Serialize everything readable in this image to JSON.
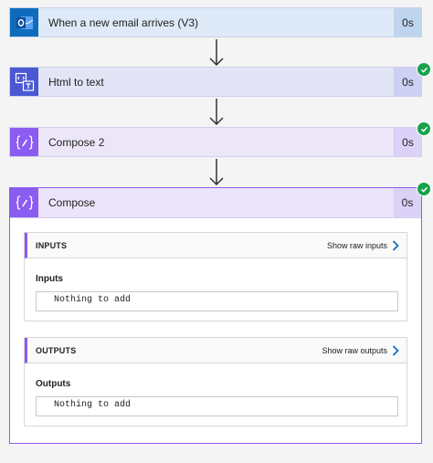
{
  "steps": [
    {
      "label": "When a new email arrives (V3)",
      "duration": "0s",
      "icon": "outlook-icon"
    },
    {
      "label": "Html to text",
      "duration": "0s",
      "icon": "html-to-text-icon"
    },
    {
      "label": "Compose 2",
      "duration": "0s",
      "icon": "compose-icon"
    }
  ],
  "compose": {
    "label": "Compose",
    "duration": "0s",
    "icon": "compose-icon",
    "inputs": {
      "title": "INPUTS",
      "link": "Show raw inputs",
      "field_label": "Inputs",
      "value": "Nothing to add"
    },
    "outputs": {
      "title": "OUTPUTS",
      "link": "Show raw outputs",
      "field_label": "Outputs",
      "value": "Nothing to add"
    }
  },
  "colors": {
    "success": "#17a34a",
    "outlook": "#0f6cbd",
    "html_to_text": "#4a59d2",
    "compose": "#8b5cf0"
  }
}
